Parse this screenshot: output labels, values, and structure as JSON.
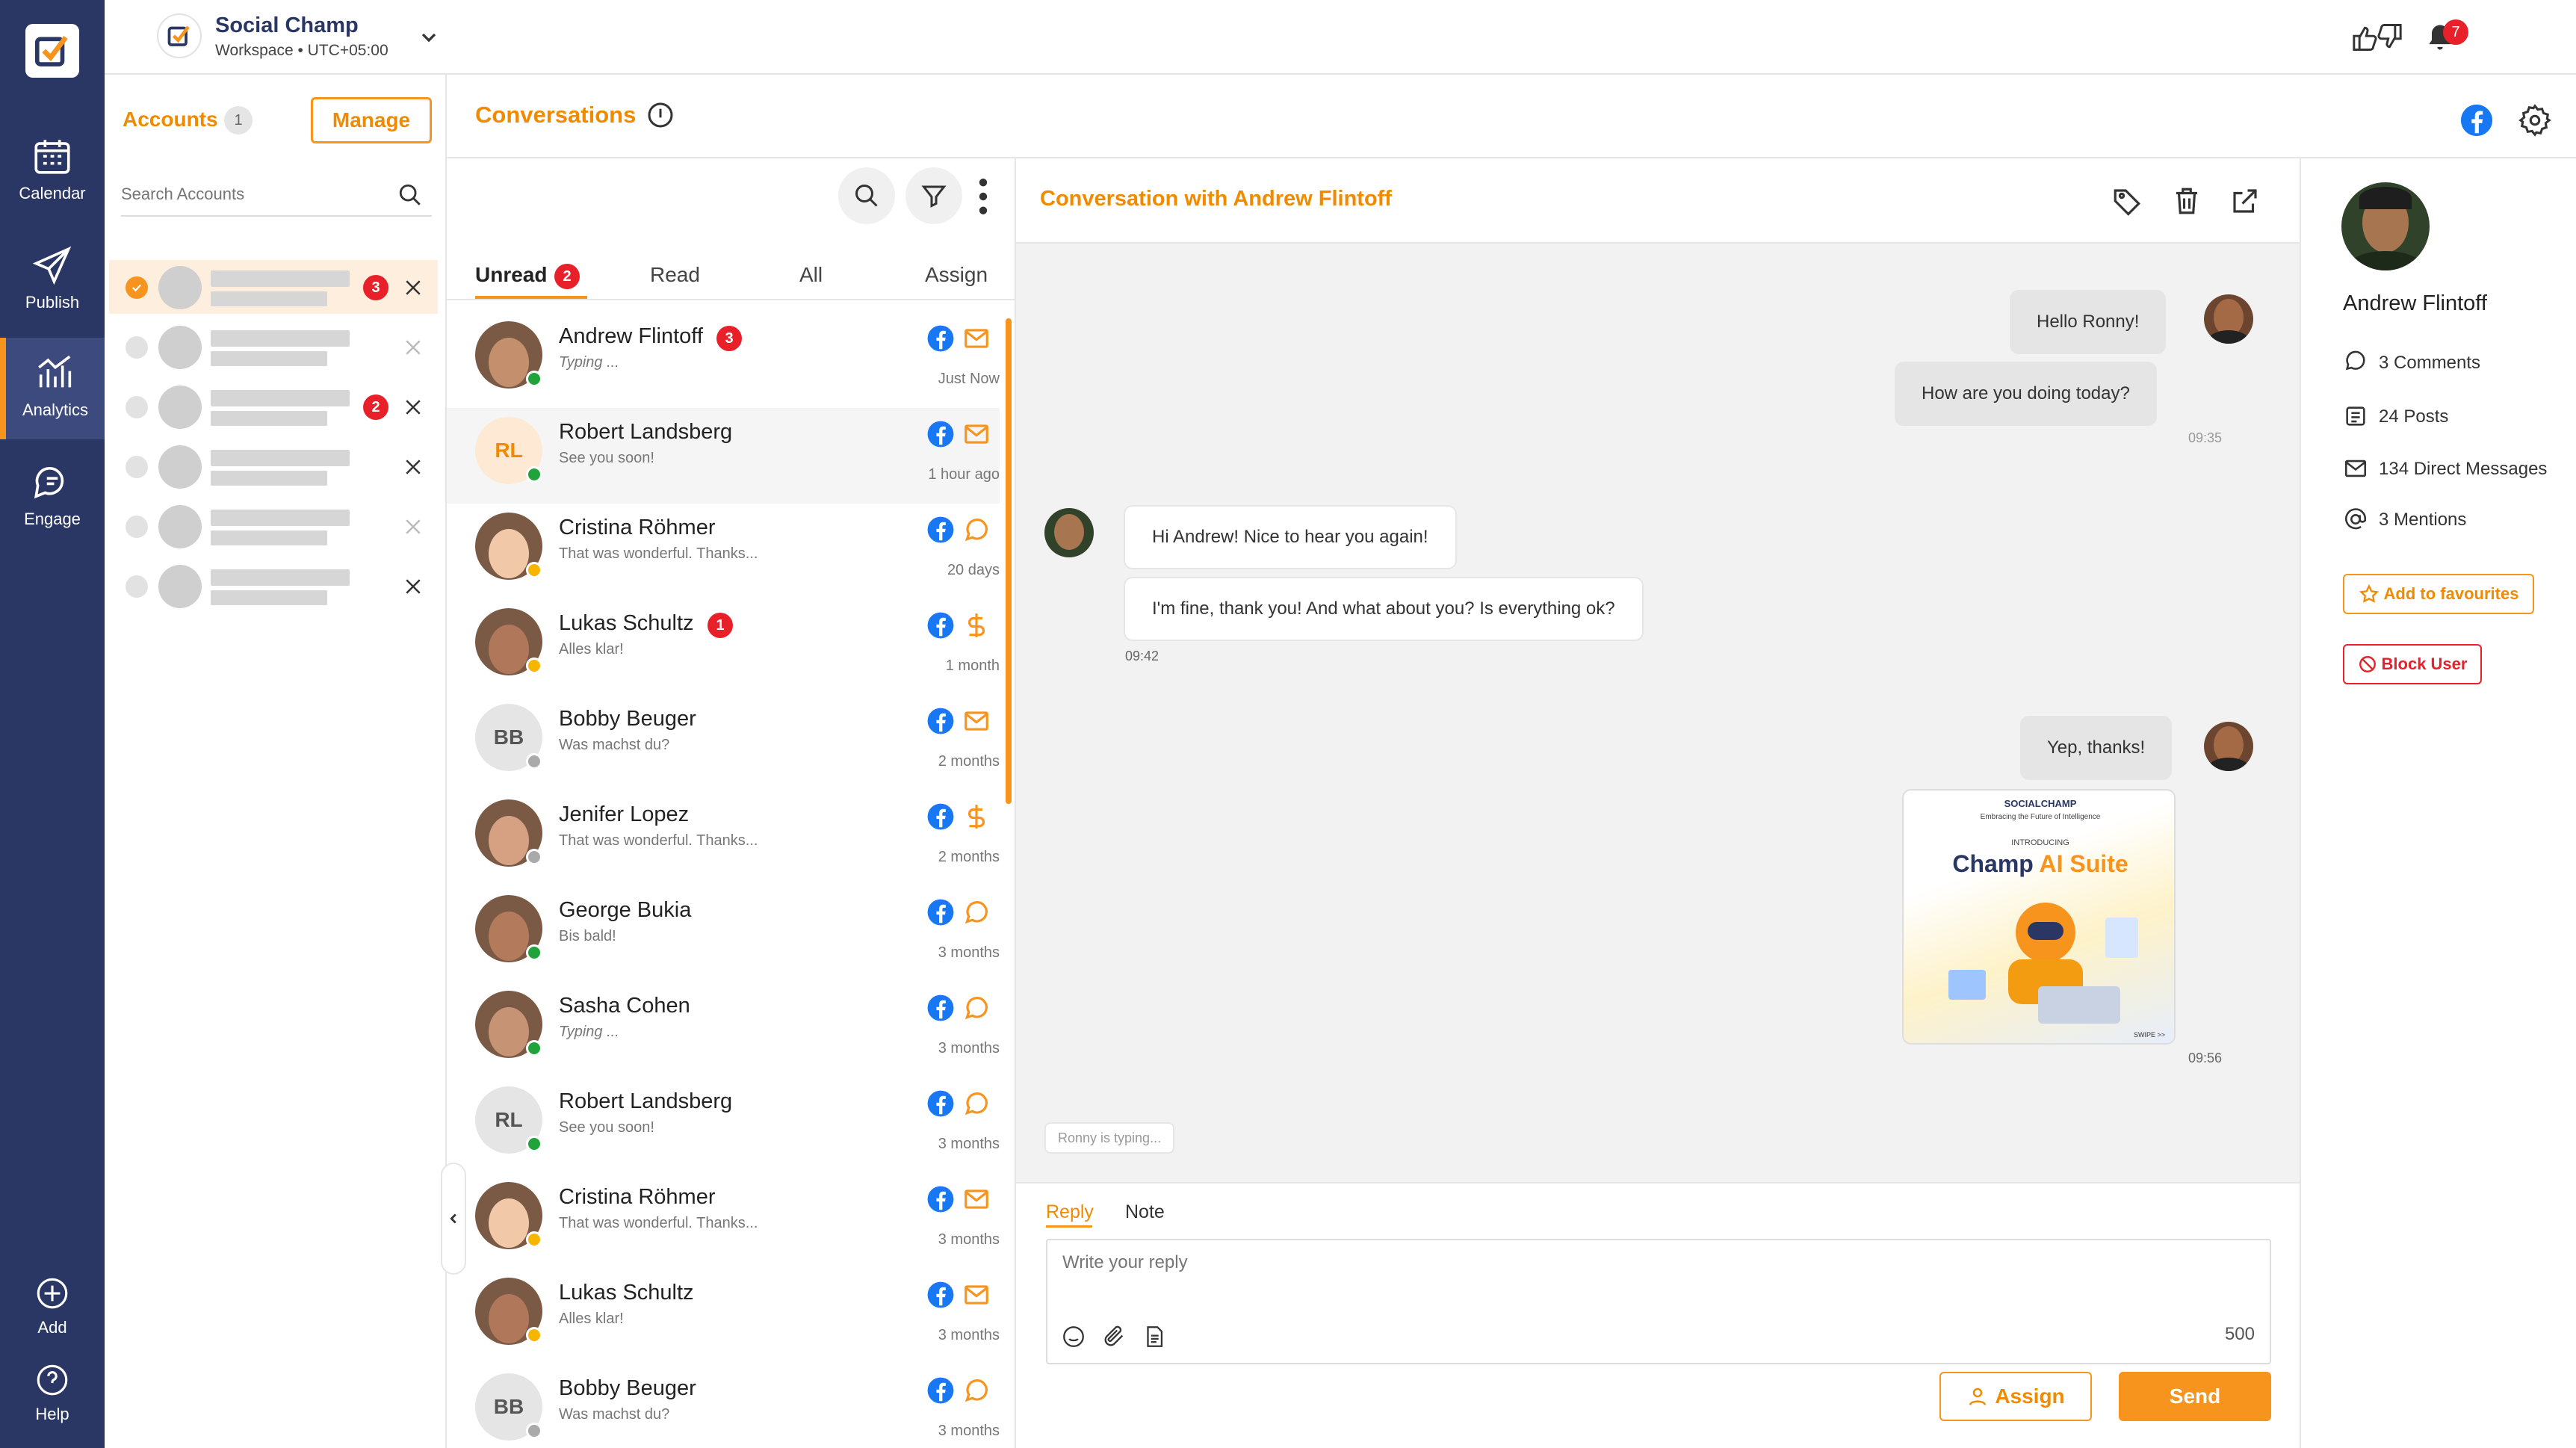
{
  "colors": {
    "nav": "#2a3765",
    "accent": "#f7941d",
    "danger": "#e8202a",
    "facebook": "#1877f2"
  },
  "workspace": {
    "name": "Social Champ",
    "sub": "Workspace • UTC+05:00"
  },
  "notifications": {
    "count": "7"
  },
  "nav": {
    "calendar": "Calendar",
    "publish": "Publish",
    "analytics": "Analytics",
    "engage": "Engage",
    "add": "Add",
    "help": "Help"
  },
  "accounts": {
    "title": "Accounts",
    "count": "1",
    "manage": "Manage",
    "search_placeholder": "Search Accounts",
    "rows": [
      {
        "badge": "3"
      },
      {
        "badge": ""
      },
      {
        "badge": "2"
      },
      {
        "badge": ""
      },
      {
        "badge": ""
      },
      {
        "badge": ""
      }
    ]
  },
  "conversations": {
    "title": "Conversations"
  },
  "tabs": {
    "unread": "Unread",
    "unread_count": "2",
    "read": "Read",
    "all": "All",
    "assign": "Assign"
  },
  "list": [
    {
      "name": "Andrew Flintoff",
      "badge": "3",
      "preview": "Typing ...",
      "time": "Just Now",
      "initials": "",
      "channel": "mail",
      "status": "#1fa33a"
    },
    {
      "name": "Robert Landsberg",
      "badge": "",
      "preview": "See you soon!",
      "time": "1 hour ago",
      "initials": "RL",
      "channel": "mail",
      "status": "#1fa33a"
    },
    {
      "name": "Cristina Röhmer",
      "badge": "",
      "preview": "That was wonderful. Thanks...",
      "time": "20 days",
      "initials": "",
      "channel": "comment",
      "status": "#f7b500"
    },
    {
      "name": "Lukas Schultz",
      "badge": "1",
      "preview": "Alles klar!",
      "time": "1 month",
      "initials": "",
      "channel": "dollar",
      "status": "#f7b500"
    },
    {
      "name": "Bobby Beuger",
      "badge": "",
      "preview": "Was machst du?",
      "time": "2 months",
      "initials": "BB",
      "channel": "mail",
      "status": "#aaaaaa"
    },
    {
      "name": "Jenifer Lopez",
      "badge": "",
      "preview": "That was wonderful. Thanks...",
      "time": "2 months",
      "initials": "",
      "channel": "dollar",
      "status": "#aaaaaa"
    },
    {
      "name": "George Bukia",
      "badge": "",
      "preview": "Bis bald!",
      "time": "3 months",
      "initials": "",
      "channel": "comment",
      "status": "#1fa33a"
    },
    {
      "name": "Sasha Cohen",
      "badge": "",
      "preview": "Typing ...",
      "time": "3 months",
      "initials": "",
      "channel": "comment",
      "status": "#1fa33a"
    },
    {
      "name": "Robert Landsberg",
      "badge": "",
      "preview": "See you soon!",
      "time": "3 months",
      "initials": "RL",
      "channel": "comment",
      "status": "#1fa33a"
    },
    {
      "name": "Cristina Röhmer",
      "badge": "",
      "preview": "That was wonderful. Thanks...",
      "time": "3 months",
      "initials": "",
      "channel": "mail",
      "status": "#f7b500"
    },
    {
      "name": "Lukas Schultz",
      "badge": "",
      "preview": "Alles klar!",
      "time": "3 months",
      "initials": "",
      "channel": "mail",
      "status": "#f7b500"
    },
    {
      "name": "Bobby Beuger",
      "badge": "",
      "preview": "Was machst du?",
      "time": "3 months",
      "initials": "BB",
      "channel": "comment",
      "status": "#aaaaaa"
    }
  ],
  "chat": {
    "title": "Conversation with Andrew Flintoff",
    "m1": "Hello Ronny!",
    "m2": "How are you doing today?",
    "t1": "09:35",
    "m3": "Hi Andrew! Nice to hear you again!",
    "m4": "I'm fine, thank you! And what about you? Is everything ok?",
    "t2": "09:42",
    "m5": "Yep, thanks!",
    "t3": "09:56",
    "typing": "Ronny is typing...",
    "image": {
      "brand": "SOCIALCHAMP",
      "tagline": "Embracing the Future of Intelligence",
      "intro": "INTRODUCING",
      "title1": "Champ ",
      "title2": "AI Suite",
      "swipe": "SWIPE >>"
    }
  },
  "reply": {
    "tab_reply": "Reply",
    "tab_note": "Note",
    "placeholder": "Write your reply",
    "limit": "500",
    "assign": "Assign",
    "send": "Send"
  },
  "profile": {
    "name": "Andrew Flintoff",
    "comments": "3 Comments",
    "posts": "24 Posts",
    "dms": "134 Direct Messages",
    "mentions": "3 Mentions",
    "fav": "Add to favourites",
    "block": "Block User"
  }
}
